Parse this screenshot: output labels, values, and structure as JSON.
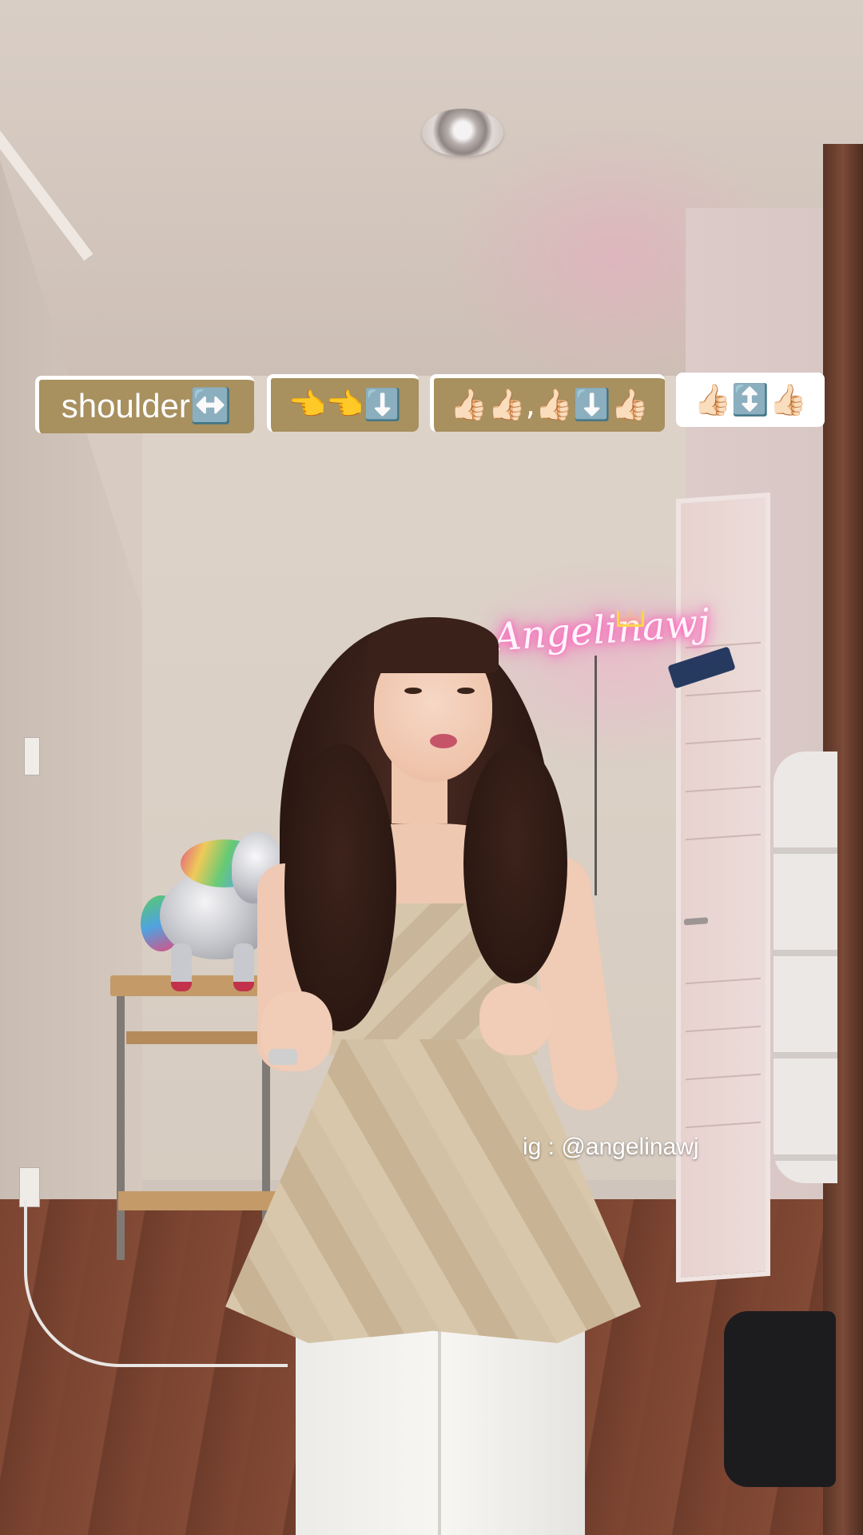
{
  "captions": {
    "cap1": "shoulder↔️",
    "cap2": "👈👈⬇️",
    "cap3": "👍🏻👍🏻,👍🏻⬇️👍🏻",
    "cap4": "👍🏻↕️👍🏻"
  },
  "neon_sign": "Angelinawj",
  "watermark": "ig : @angelinawj",
  "colors": {
    "caption_tan": "#a8905f",
    "caption_white": "#ffffff",
    "neon_pink": "#ff5ab8"
  }
}
